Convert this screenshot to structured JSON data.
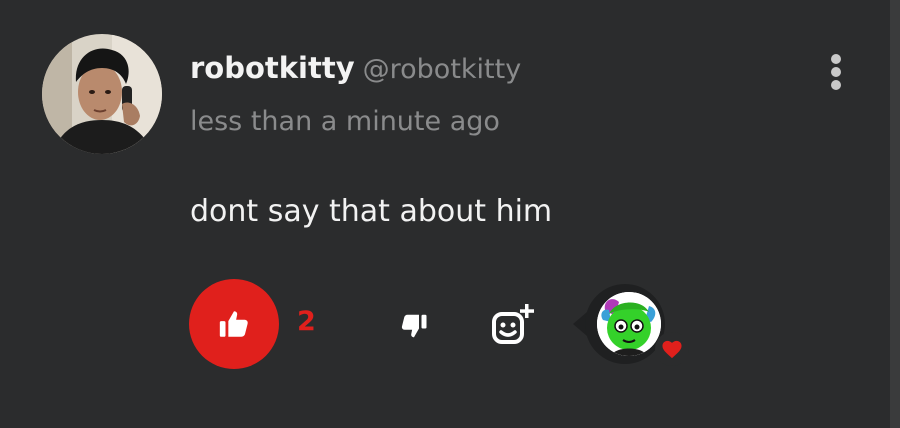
{
  "comment": {
    "username": "robotkitty",
    "handle": "@robotkitty",
    "timestamp": "less than a minute ago",
    "text": "dont say that about him"
  },
  "actions": {
    "like_count": "2",
    "liked": true,
    "reaction_icon": "heart-icon"
  },
  "colors": {
    "background": "#2b2c2d",
    "accent_red": "#e0201c",
    "muted_text": "#8a8b8c",
    "primary_text": "#f2f2f2"
  },
  "icons": {
    "avatar": "user-avatar-photo",
    "more": "more-vertical-icon",
    "like": "thumbs-up-icon",
    "dislike": "thumbs-down-icon",
    "add_reaction": "add-reaction-icon",
    "reactor_avatar": "reactor-avatar",
    "reaction_badge": "heart-icon"
  }
}
